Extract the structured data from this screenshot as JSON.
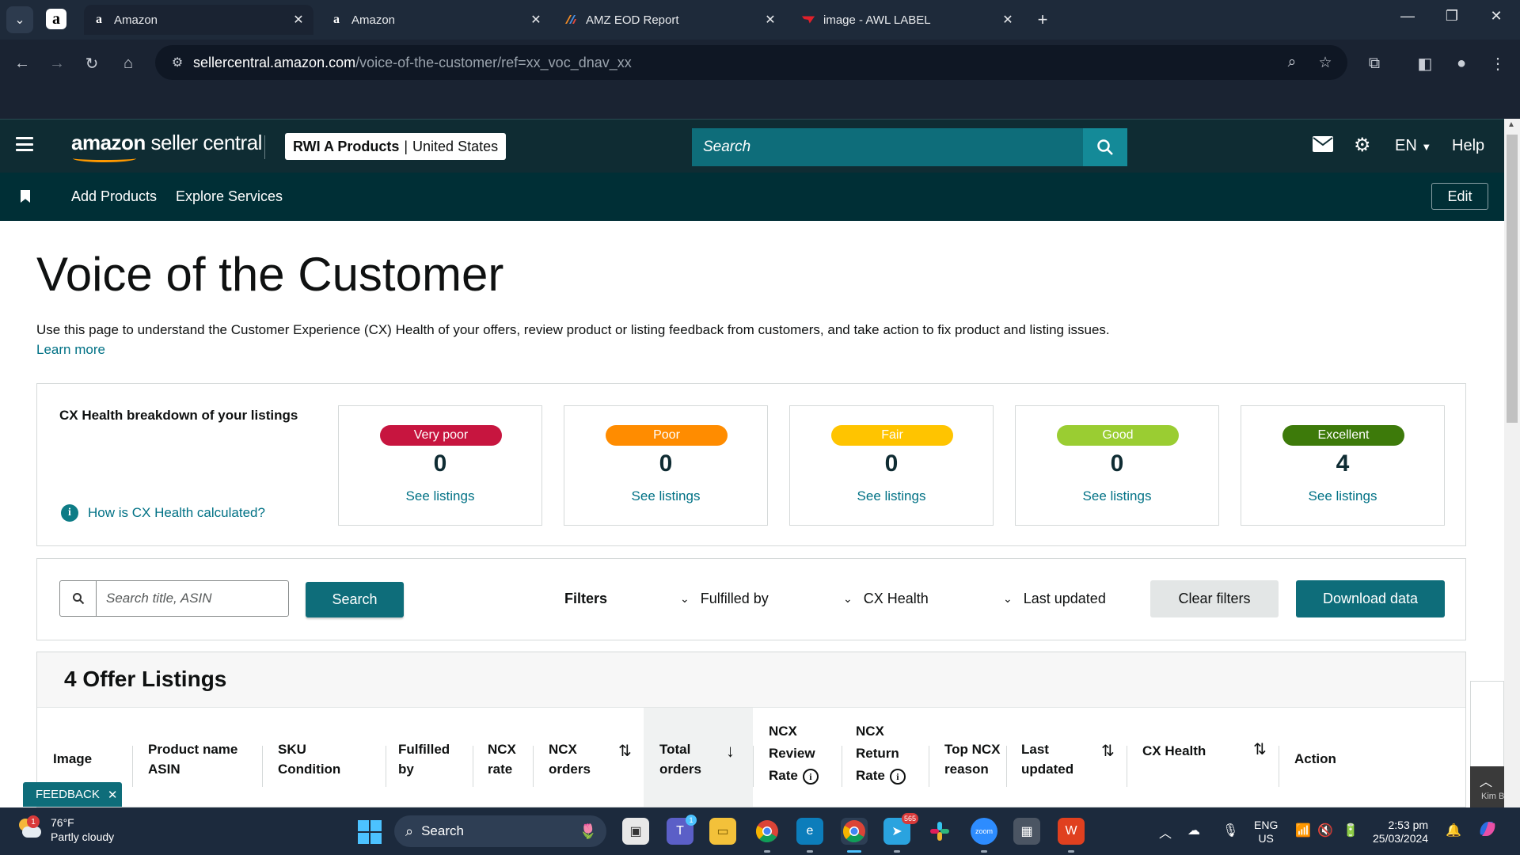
{
  "browser": {
    "tabs": [
      {
        "favicon": "a",
        "title": "Amazon",
        "active": true
      },
      {
        "favicon": "a",
        "title": "Amazon",
        "active": false
      },
      {
        "favicon": "amz-eod-icon",
        "title": "AMZ EOD Report",
        "active": false
      },
      {
        "favicon": "awl-label-icon",
        "title": "image - AWL LABEL",
        "active": false
      }
    ],
    "url_host": "sellercentral.amazon.com",
    "url_path": "/voice-of-the-customer/ref=xx_voc_dnav_xx"
  },
  "header": {
    "logo_text_1": "amazon",
    "logo_text_2": " seller central",
    "store_name": "RWI A Products",
    "store_sep": "|",
    "store_region": "United States",
    "search_placeholder": "Search",
    "language": "EN",
    "help": "Help"
  },
  "subnav": {
    "items": [
      "Add Products",
      "Explore Services"
    ],
    "edit": "Edit"
  },
  "page": {
    "title": "Voice of the Customer",
    "description": "Use this page to understand the Customer Experience (CX) Health of your offers, review product or listing feedback from customers, and take action to fix product and listing issues.",
    "learn_more": "Learn more"
  },
  "cx_health": {
    "heading": "CX Health breakdown of your listings",
    "how_link": "How is CX Health calculated?",
    "tiles": [
      {
        "label": "Very poor",
        "count": "0",
        "link": "See listings",
        "color": "#c7153f"
      },
      {
        "label": "Poor",
        "count": "0",
        "link": "See listings",
        "color": "#ff8c00"
      },
      {
        "label": "Fair",
        "count": "0",
        "link": "See listings",
        "color": "#ffc400"
      },
      {
        "label": "Good",
        "count": "0",
        "link": "See listings",
        "color": "#9acd32"
      },
      {
        "label": "Excellent",
        "count": "4",
        "link": "See listings",
        "color": "#3d7a0a"
      }
    ]
  },
  "filters": {
    "search_placeholder": "Search title, ASIN",
    "search_button": "Search",
    "label": "Filters",
    "dropdowns": [
      "Fulfilled by",
      "CX Health",
      "Last updated"
    ],
    "clear": "Clear filters",
    "download": "Download data"
  },
  "table": {
    "title": "4 Offer Listings",
    "columns": [
      {
        "line1": "Image",
        "line2": ""
      },
      {
        "line1": "Product name",
        "line2": "ASIN"
      },
      {
        "line1": "SKU",
        "line2": "Condition"
      },
      {
        "line1": "Fulfilled",
        "line2": "by"
      },
      {
        "line1": "NCX",
        "line2": "rate"
      },
      {
        "line1": "NCX",
        "line2": "orders"
      },
      {
        "line1": "Total",
        "line2": "orders"
      },
      {
        "line1": "NCX",
        "line2": "Review",
        "line3": "Rate"
      },
      {
        "line1": "NCX",
        "line2": "Return",
        "line3": "Rate"
      },
      {
        "line1": "Top NCX",
        "line2": "reason"
      },
      {
        "line1": "Last",
        "line2": "updated"
      },
      {
        "line1": "CX Health",
        "line2": ""
      },
      {
        "line1": "Action",
        "line2": ""
      }
    ]
  },
  "feedback": {
    "label": "FEEDBACK"
  },
  "chat_widget": {
    "label": "Kim B"
  },
  "taskbar": {
    "weather_temp": "76°F",
    "weather_desc": "Partly cloudy",
    "weather_badge": "1",
    "search": "Search",
    "lang_top": "ENG",
    "lang_bottom": "US",
    "time": "2:53 pm",
    "date": "25/03/2024",
    "teams_badge": "1",
    "telegram_badge": "565"
  },
  "colors": {
    "amazon_header": "#0f2c33",
    "teal_button": "#0e6d7a",
    "link": "#007185"
  }
}
